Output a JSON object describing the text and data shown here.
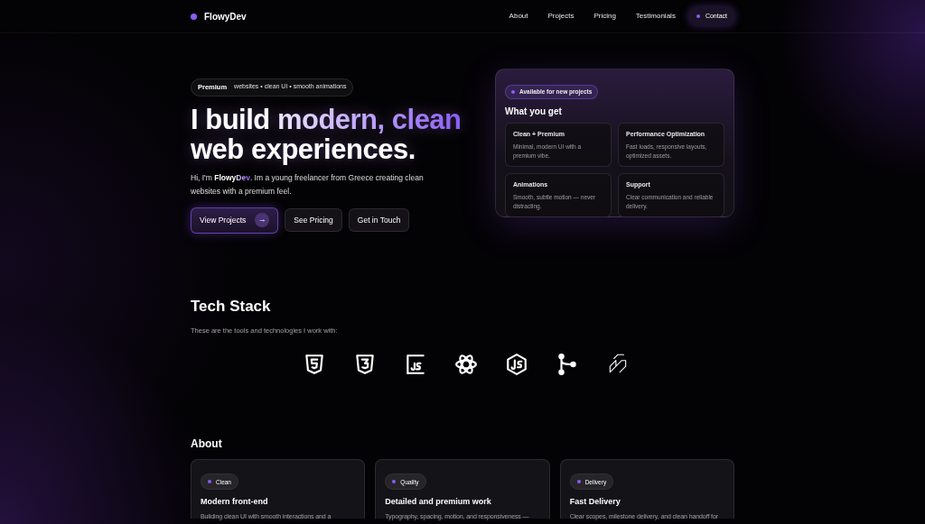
{
  "nav": {
    "brand": "FlowyDev",
    "links": [
      "About",
      "Projects",
      "Pricing",
      "Testimonials"
    ],
    "cta": "Contact"
  },
  "hero": {
    "badge": {
      "strong": "Premium",
      "text": "websites • clean UI • smooth animations"
    },
    "title": [
      {
        "text": "I build ",
        "kind": "plain"
      },
      {
        "text": "modern, clean",
        "kind": "accent"
      },
      {
        "text": " web experiences.",
        "kind": "plain"
      }
    ],
    "intro": [
      {
        "text": "Hi, I'm ",
        "kind": "plain"
      },
      {
        "text": "Flowy",
        "kind": "bold"
      },
      {
        "text": "Dev",
        "kind": "accent"
      },
      {
        "text": ". Im a young freelancer from Greece creating clean websites with a premium feel.",
        "kind": "plain"
      }
    ],
    "buttons": [
      {
        "label": "View Projects",
        "kind": "primary",
        "arrow": "→"
      },
      {
        "label": "See Pricing",
        "kind": "secondary"
      },
      {
        "label": "Get in Touch",
        "kind": "secondary"
      }
    ]
  },
  "offer": {
    "status": "Available for new projects",
    "title": "What you get",
    "items": [
      {
        "title": "Clean + Premium",
        "text": "Minimal, modern UI with a premium vibe."
      },
      {
        "title": "Performance Optimization",
        "text": "Fast loads, responsive layouts, optimized assets."
      },
      {
        "title": "Animations",
        "text": "Smooth, subtle motion — never distracting."
      },
      {
        "title": "Support",
        "text": "Clear communication and reliable delivery."
      }
    ]
  },
  "tech_stack": {
    "title": "Tech Stack",
    "subtitle": "These are the tools and technologies I work with:"
  },
  "about": {
    "title": "About",
    "cards": [
      {
        "tag": "Clean",
        "title": "Modern front-end",
        "text": "Building clean UI with smooth interactions and a"
      },
      {
        "tag": "Quality",
        "title": "Detailed and premium work",
        "text": "Typography, spacing, motion, and responsiveness —"
      },
      {
        "tag": "Delivery",
        "title": "Fast Delivery",
        "text": "Clear scopes, milestone delivery, and clean handoff for"
      }
    ]
  }
}
